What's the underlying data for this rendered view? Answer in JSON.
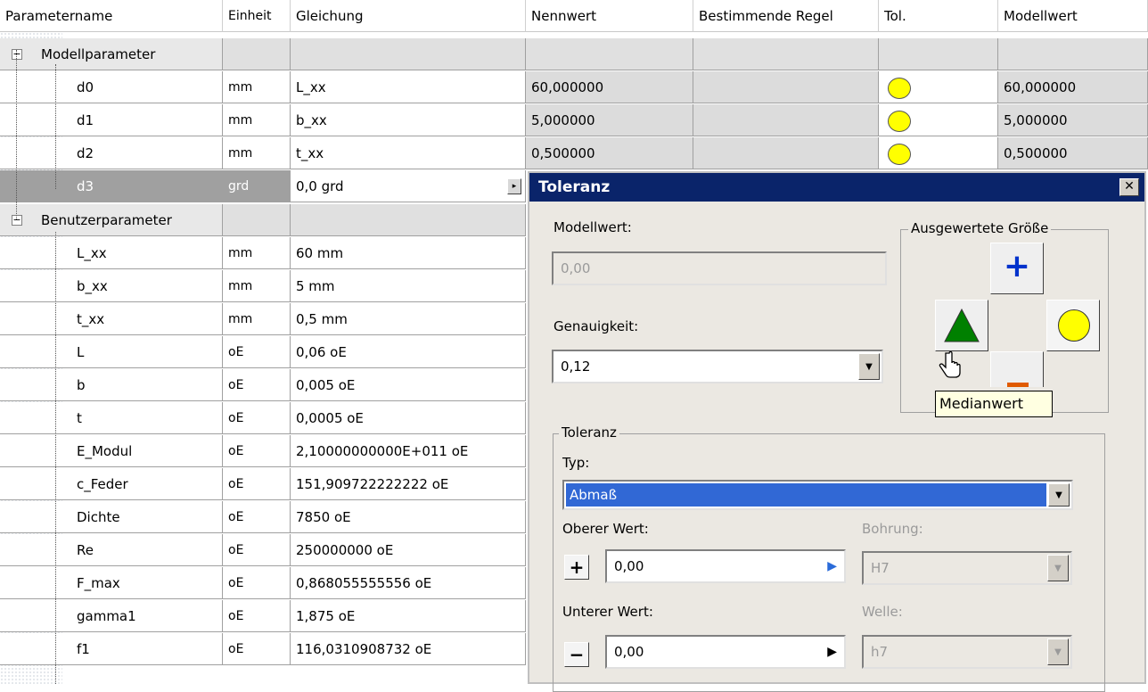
{
  "columns": {
    "name": "Parametername",
    "unit": "Einheit",
    "equation": "Gleichung",
    "nominal": "Nennwert",
    "rule": "Bestimmende Regel",
    "tol": "Tol.",
    "model": "Modellwert"
  },
  "group_model": {
    "label": "Modellparameter",
    "expander": "−"
  },
  "model_params": [
    {
      "name": "d0",
      "unit": "mm",
      "equation": "L_xx",
      "nominal": "60,000000",
      "model": "60,000000"
    },
    {
      "name": "d1",
      "unit": "mm",
      "equation": "b_xx",
      "nominal": "5,000000",
      "model": "5,000000"
    },
    {
      "name": "d2",
      "unit": "mm",
      "equation": "t_xx",
      "nominal": "0,500000",
      "model": "0,500000"
    },
    {
      "name": "d3",
      "unit": "grd",
      "equation": "0,0 grd"
    }
  ],
  "group_user": {
    "label": "Benutzerparameter",
    "expander": "−"
  },
  "user_params": [
    {
      "name": "L_xx",
      "unit": "mm",
      "equation": "60 mm"
    },
    {
      "name": "b_xx",
      "unit": "mm",
      "equation": "5 mm"
    },
    {
      "name": "t_xx",
      "unit": "mm",
      "equation": "0,5 mm"
    },
    {
      "name": "L",
      "unit": "oE",
      "equation": "0,06 oE"
    },
    {
      "name": "b",
      "unit": "oE",
      "equation": "0,005 oE"
    },
    {
      "name": "t",
      "unit": "oE",
      "equation": "0,0005 oE"
    },
    {
      "name": "E_Modul",
      "unit": "oE",
      "equation": "2,10000000000E+011 oE"
    },
    {
      "name": "c_Feder",
      "unit": "oE",
      "equation": "151,909722222222 oE"
    },
    {
      "name": "Dichte",
      "unit": "oE",
      "equation": "7850 oE"
    },
    {
      "name": "Re",
      "unit": "oE",
      "equation": "250000000 oE"
    },
    {
      "name": "F_max",
      "unit": "oE",
      "equation": "0,868055555556 oE"
    },
    {
      "name": "gamma1",
      "unit": "oE",
      "equation": "1,875 oE"
    },
    {
      "name": "f1",
      "unit": "oE",
      "equation": "116,0310908732 oE"
    }
  ],
  "dialog": {
    "title": "Toleranz",
    "close": "✕",
    "model_value_label": "Modellwert:",
    "model_value": "0,00",
    "precision_label": "Genauigkeit:",
    "precision_value": "0,12",
    "evaluated_size_label": "Ausgewertete Größe",
    "plus": "+",
    "minus": "−",
    "tooltip": "Medianwert",
    "tolerance_group_label": "Toleranz",
    "type_label": "Typ:",
    "type_value": "Abmaß",
    "upper_label": "Oberer Wert:",
    "upper_value": "0,00",
    "lower_label": "Unterer Wert:",
    "lower_value": "0,00",
    "bore_label": "Bohrung:",
    "bore_value": "H7",
    "shaft_label": "Welle:",
    "shaft_value": "h7"
  },
  "colors": {
    "titlebar": "#0a246a",
    "tol_dot": "#ffff00",
    "triangle": "#008000",
    "plus": "#0033cc",
    "minus": "#e05a00",
    "selection": "#3168d5"
  }
}
